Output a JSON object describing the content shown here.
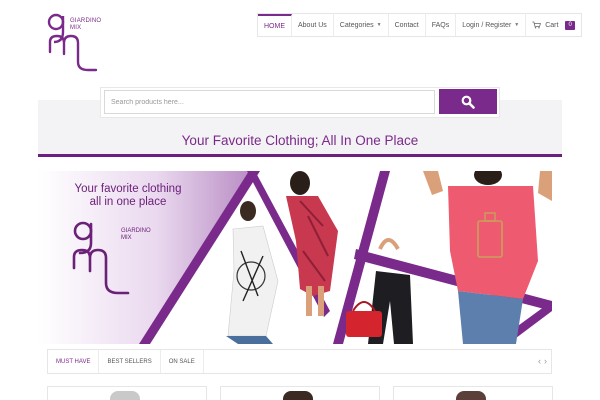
{
  "brand": {
    "logo_line1": "GIARDINO",
    "logo_line2": "MIX",
    "accent_color": "#7a2a8a"
  },
  "nav": {
    "items": [
      {
        "label": "HOME",
        "active": true
      },
      {
        "label": "About Us"
      },
      {
        "label": "Categories",
        "has_caret": true
      },
      {
        "label": "Contact"
      },
      {
        "label": "FAQs"
      },
      {
        "label": "Login / Register",
        "has_caret": true
      }
    ],
    "cart_label": "Cart",
    "cart_count": "0",
    "cart_icon": "cart-icon"
  },
  "search": {
    "placeholder": "Search products here...",
    "button_icon": "search-icon"
  },
  "tagline": "Your Favorite Clothing; All In One Place",
  "hero": {
    "caption_line1": "Your favorite clothing",
    "caption_line2": "all in one place",
    "logo_line1": "GIARDINO",
    "logo_line2": "MIX"
  },
  "tabs": {
    "items": [
      {
        "label": "MUST HAVE",
        "active": true
      },
      {
        "label": "BEST SELLERS"
      },
      {
        "label": "ON SALE"
      }
    ],
    "prev_icon": "chevron-left-icon",
    "next_icon": "chevron-right-icon"
  }
}
